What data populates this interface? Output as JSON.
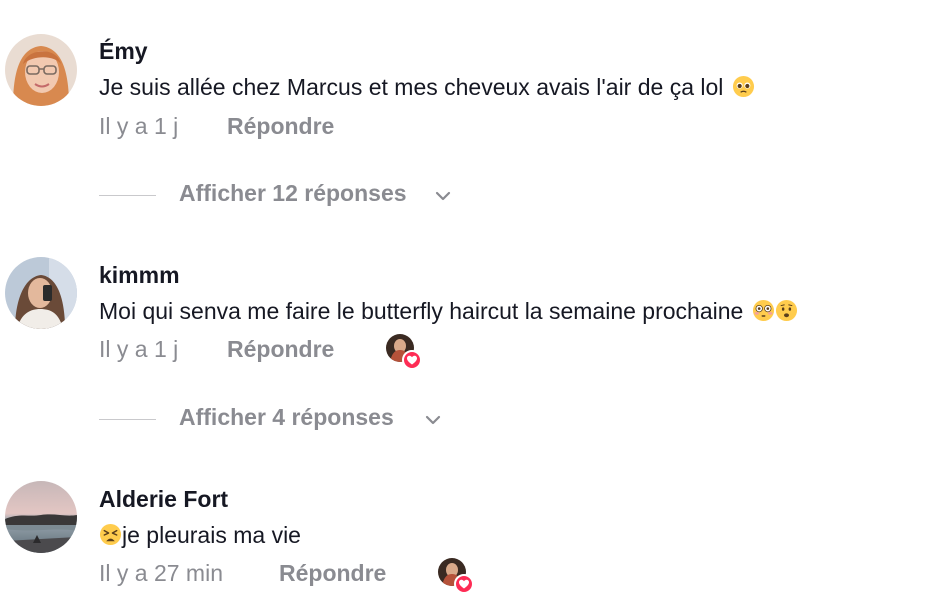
{
  "comments": [
    {
      "username": "Émy",
      "text": "Je suis allée chez Marcus et mes cheveux avais l'air de ça lol",
      "emojis": [
        "pleading-face"
      ],
      "time": "Il y a 1 j",
      "reply_label": "Répondre",
      "view_replies": "Afficher 12 réponses"
    },
    {
      "username": "kimmm",
      "text": "Moi qui senva me faire le butterfly haircut la semaine prochaine",
      "emojis": [
        "flushed-face",
        "anguished-face"
      ],
      "time": "Il y a 1 j",
      "reply_label": "Répondre",
      "creator_liked": true,
      "view_replies": "Afficher 4 réponses"
    },
    {
      "username": "Alderie Fort",
      "text": "je pleurais ma vie",
      "emojis": [
        "tired-face"
      ],
      "time": "Il y a 27 min",
      "reply_label": "Répondre",
      "creator_liked": true
    }
  ],
  "colors": {
    "text_primary": "#161823",
    "text_secondary": "#8a8b91",
    "like_heart": "#fe2c55"
  }
}
